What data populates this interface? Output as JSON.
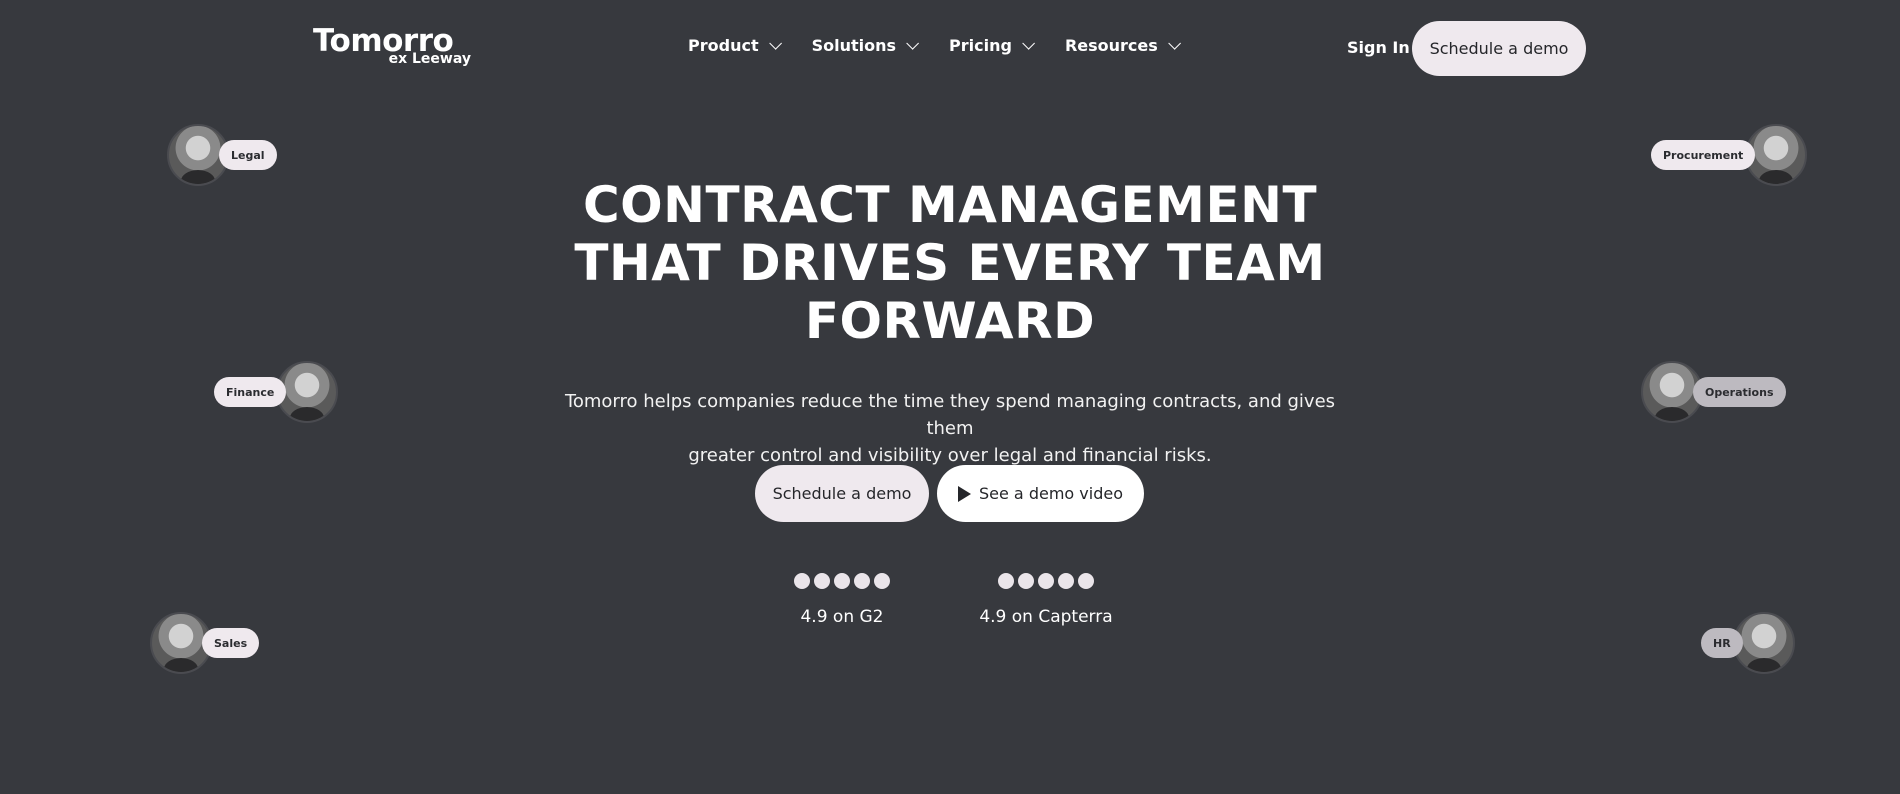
{
  "brand": {
    "name": "Tomorro",
    "sub": "ex Leeway"
  },
  "nav": {
    "items": [
      {
        "label": "Product"
      },
      {
        "label": "Solutions"
      },
      {
        "label": "Pricing"
      },
      {
        "label": "Resources"
      }
    ],
    "sign_in": "Sign In",
    "cta": "Schedule a demo"
  },
  "hero": {
    "headline_lines": [
      "CONTRACT MANAGEMENT",
      "THAT DRIVES EVERY TEAM",
      "FORWARD"
    ],
    "subhead_lines": [
      "Tomorro helps companies reduce the time they spend managing contracts, and gives them",
      "greater control and visibility over legal and financial risks."
    ],
    "primary_cta": "Schedule a demo",
    "secondary_cta": "See a demo video"
  },
  "ratings": [
    {
      "label": "4.9 on G2",
      "dots": 5
    },
    {
      "label": "4.9 on Capterra",
      "dots": 5
    }
  ],
  "roles": {
    "legal": "Legal",
    "procurement": "Procurement",
    "finance": "Finance",
    "operations": "Operations",
    "sales": "Sales",
    "hr": "HR"
  },
  "colors": {
    "background": "#37393e",
    "button_light": "#efe9ee",
    "button_white": "#ffffff",
    "text": "#ffffff"
  }
}
